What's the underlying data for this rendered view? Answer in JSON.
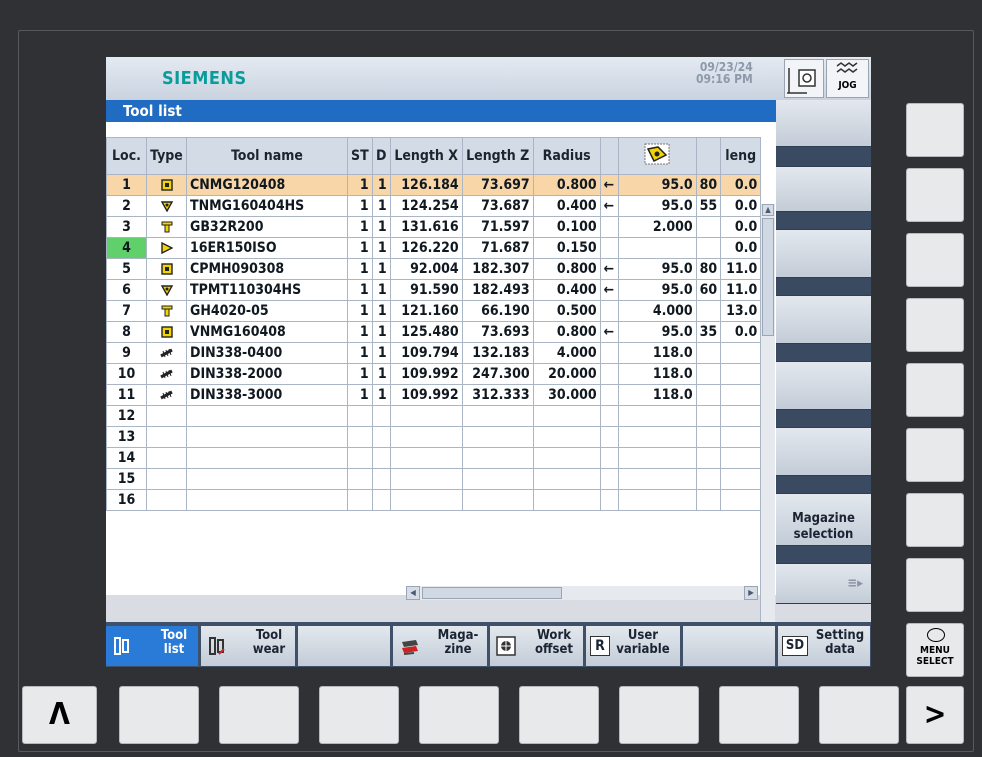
{
  "header": {
    "brand": "SIEMENS",
    "date": "09/23/24",
    "time": "09:16 PM",
    "mode": "JOG"
  },
  "title": "Tool list",
  "table": {
    "columns": [
      "Loc.",
      "Type",
      "Tool name",
      "ST",
      "D",
      "Length X",
      "Length Z",
      "Radius",
      "",
      "",
      "",
      "leng"
    ],
    "rows": [
      {
        "loc": "1",
        "type": "cutting-insert",
        "name": "CNMG120408",
        "st": "1",
        "d": "1",
        "lx": "126.184",
        "lz": "73.697",
        "r": "0.800",
        "dir": "←",
        "a": "95.0",
        "b": "80",
        "c": "0.0",
        "selected": true,
        "active": false
      },
      {
        "loc": "2",
        "type": "triangle-insert",
        "name": "TNMG160404HS",
        "st": "1",
        "d": "1",
        "lx": "124.254",
        "lz": "73.687",
        "r": "0.400",
        "dir": "←",
        "a": "95.0",
        "b": "55",
        "c": "0.0",
        "selected": false,
        "active": false
      },
      {
        "loc": "3",
        "type": "grooving-tool",
        "name": "GB32R200",
        "st": "1",
        "d": "1",
        "lx": "131.616",
        "lz": "71.597",
        "r": "0.100",
        "dir": "",
        "a": "2.000",
        "b": "",
        "c": "0.0",
        "selected": false,
        "active": false
      },
      {
        "loc": "4",
        "type": "thread-insert",
        "name": "16ER150ISO",
        "st": "1",
        "d": "1",
        "lx": "126.220",
        "lz": "71.687",
        "r": "0.150",
        "dir": "",
        "a": "",
        "b": "",
        "c": "0.0",
        "selected": false,
        "active": true
      },
      {
        "loc": "5",
        "type": "cutting-insert",
        "name": "CPMH090308",
        "st": "1",
        "d": "1",
        "lx": "92.004",
        "lz": "182.307",
        "r": "0.800",
        "dir": "←",
        "a": "95.0",
        "b": "80",
        "c": "11.0",
        "selected": false,
        "active": false
      },
      {
        "loc": "6",
        "type": "triangle-insert",
        "name": "TPMT110304HS",
        "st": "1",
        "d": "1",
        "lx": "91.590",
        "lz": "182.493",
        "r": "0.400",
        "dir": "←",
        "a": "95.0",
        "b": "60",
        "c": "11.0",
        "selected": false,
        "active": false
      },
      {
        "loc": "7",
        "type": "grooving-tool",
        "name": "GH4020-05",
        "st": "1",
        "d": "1",
        "lx": "121.160",
        "lz": "66.190",
        "r": "0.500",
        "dir": "",
        "a": "4.000",
        "b": "",
        "c": "13.0",
        "selected": false,
        "active": false
      },
      {
        "loc": "8",
        "type": "cutting-insert",
        "name": "VNMG160408",
        "st": "1",
        "d": "1",
        "lx": "125.480",
        "lz": "73.693",
        "r": "0.800",
        "dir": "←",
        "a": "95.0",
        "b": "35",
        "c": "0.0",
        "selected": false,
        "active": false
      },
      {
        "loc": "9",
        "type": "drill",
        "name": "DIN338-0400",
        "st": "1",
        "d": "1",
        "lx": "109.794",
        "lz": "132.183",
        "r": "4.000",
        "dir": "",
        "a": "118.0",
        "b": "",
        "c": "",
        "selected": false,
        "active": false
      },
      {
        "loc": "10",
        "type": "drill",
        "name": "DIN338-2000",
        "st": "1",
        "d": "1",
        "lx": "109.992",
        "lz": "247.300",
        "r": "20.000",
        "dir": "",
        "a": "118.0",
        "b": "",
        "c": "",
        "selected": false,
        "active": false
      },
      {
        "loc": "11",
        "type": "drill",
        "name": "DIN338-3000",
        "st": "1",
        "d": "1",
        "lx": "109.992",
        "lz": "312.333",
        "r": "30.000",
        "dir": "",
        "a": "118.0",
        "b": "",
        "c": "",
        "selected": false,
        "active": false
      },
      {
        "loc": "12",
        "type": "",
        "name": "",
        "st": "",
        "d": "",
        "lx": "",
        "lz": "",
        "r": "",
        "dir": "",
        "a": "",
        "b": "",
        "c": "",
        "selected": false,
        "active": false
      },
      {
        "loc": "13",
        "type": "",
        "name": "",
        "st": "",
        "d": "",
        "lx": "",
        "lz": "",
        "r": "",
        "dir": "",
        "a": "",
        "b": "",
        "c": "",
        "selected": false,
        "active": false
      },
      {
        "loc": "14",
        "type": "",
        "name": "",
        "st": "",
        "d": "",
        "lx": "",
        "lz": "",
        "r": "",
        "dir": "",
        "a": "",
        "b": "",
        "c": "",
        "selected": false,
        "active": false
      },
      {
        "loc": "15",
        "type": "",
        "name": "",
        "st": "",
        "d": "",
        "lx": "",
        "lz": "",
        "r": "",
        "dir": "",
        "a": "",
        "b": "",
        "c": "",
        "selected": false,
        "active": false
      },
      {
        "loc": "16",
        "type": "",
        "name": "",
        "st": "",
        "d": "",
        "lx": "",
        "lz": "",
        "r": "",
        "dir": "",
        "a": "",
        "b": "",
        "c": "",
        "selected": false,
        "active": false
      }
    ]
  },
  "vertical_softkeys": {
    "magazine_line1": "Magazine",
    "magazine_line2": "selection"
  },
  "horizontal_softkeys": {
    "tool_list_1": "Tool",
    "tool_list_2": "list",
    "tool_wear_1": "Tool",
    "tool_wear_2": "wear",
    "magazine_1": "Maga-",
    "magazine_2": "zine",
    "work_offset_1": "Work",
    "work_offset_2": "offset",
    "user_var_icon": "R",
    "user_var_1": "User",
    "user_var_2": "variable",
    "setting_icon": "SD",
    "setting_1": "Setting",
    "setting_2": "data"
  },
  "hardware": {
    "menu_select_1": "MENU",
    "menu_select_2": "SELECT",
    "recall": "Λ",
    "etc": ">"
  },
  "colors": {
    "title_bar": "#1f6cc2",
    "selected_row": "#f8d6a8",
    "active_loc": "#5fd06a",
    "brand": "#0a9b9b"
  }
}
